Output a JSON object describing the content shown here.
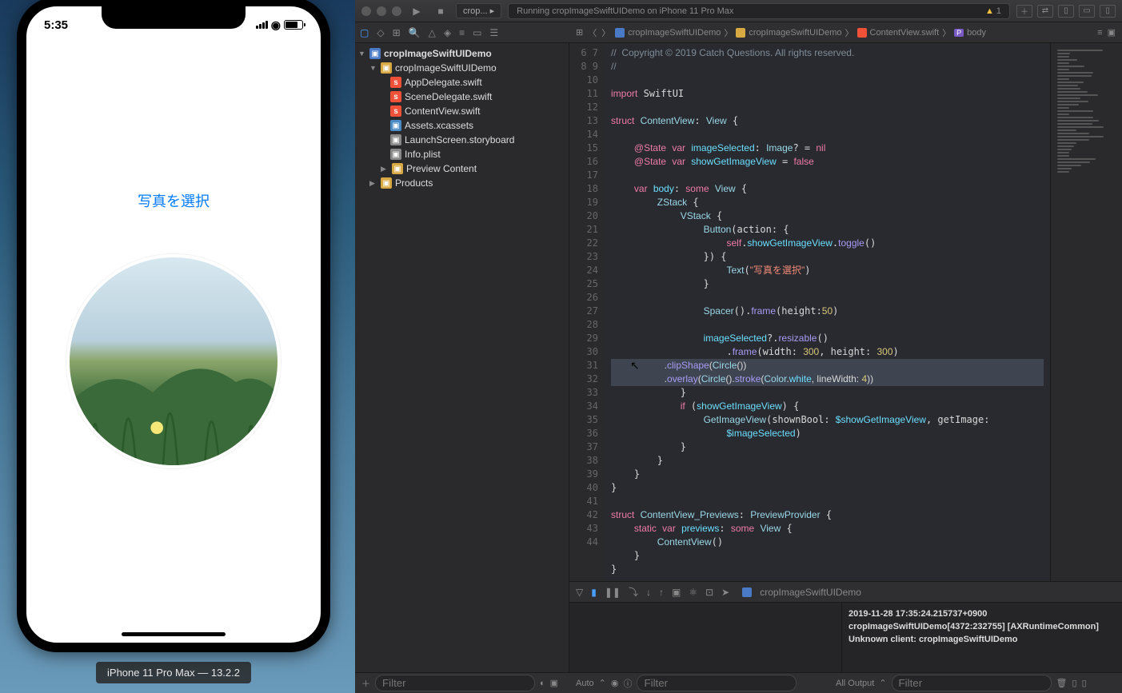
{
  "simulator": {
    "time": "5:35",
    "button_label": "写真を選択",
    "device_label": "iPhone 11 Pro Max — 13.2.2"
  },
  "toolbar": {
    "scheme": "crop...",
    "status_text": "Running cropImageSwiftUIDemo on iPhone 11 Pro Max",
    "warning_count": "1"
  },
  "breadcrumb": {
    "project": "cropImageSwiftUIDemo",
    "folder": "cropImageSwiftUIDemo",
    "file": "ContentView.swift",
    "symbol": "body",
    "symbol_prefix": "P"
  },
  "tree": {
    "root": "cropImageSwiftUIDemo",
    "folder": "cropImageSwiftUIDemo",
    "files": [
      "AppDelegate.swift",
      "SceneDelegate.swift",
      "ContentView.swift",
      "Assets.xcassets",
      "LaunchScreen.storyboard",
      "Info.plist"
    ],
    "preview": "Preview Content",
    "products": "Products"
  },
  "code": {
    "line_start": 6,
    "line_end": 43,
    "lines_html": [
      "<span class='cmt'>//  Copyright © 2019 Catch Questions. All rights reserved.</span>",
      "<span class='cmt'>//</span>",
      "",
      "<span class='kw'>import</span> SwiftUI",
      "",
      "<span class='kw'>struct</span> <span class='type'>ContentView</span>: <span class='type'>View</span> {",
      "",
      "    <span class='kw'>@State</span> <span class='kw'>var</span> <span class='var'>imageSelected</span>: <span class='type'>Image</span>? = <span class='kw'>nil</span>",
      "    <span class='kw'>@State</span> <span class='kw'>var</span> <span class='var'>showGetImageView</span> = <span class='kw'>false</span>",
      "",
      "    <span class='kw'>var</span> <span class='var'>body</span>: <span class='kw'>some</span> <span class='type'>View</span> {",
      "        <span class='type'>ZStack</span> {",
      "            <span class='type'>VStack</span> {",
      "                <span class='type'>Button</span>(action: {",
      "                    <span class='self'>self</span>.<span class='var'>showGetImageView</span>.<span class='fn'>toggle</span>()",
      "                }) {",
      "                    <span class='type'>Text</span>(<span class='str'>\"写真を選択\"</span>)",
      "                }",
      "",
      "                <span class='type'>Spacer</span>().<span class='fn'>frame</span>(height:<span class='num'>50</span>)",
      "",
      "                <span class='var'>imageSelected</span>?.<span class='fn'>resizable</span>()",
      "                    .<span class='fn'>frame</span>(width: <span class='num'>300</span>, height: <span class='num'>300</span>)",
      "                    .<span class='fn'>clipShape</span>(<span class='type'>Circle</span>())",
      "                    .<span class='fn'>overlay</span>(<span class='type'>Circle</span>().<span class='fn'>stroke</span>(<span class='type'>Color</span>.<span class='var'>white</span>, lineWidth: <span class='num'>4</span>))",
      "            }",
      "            <span class='kw'>if</span> (<span class='var'>showGetImageView</span>) {",
      "                <span class='type'>GetImageView</span>(shownBool: <span class='var'>$showGetImageView</span>, getImage:",
      "                    <span class='var'>$imageSelected</span>)",
      "            }",
      "        }",
      "    }",
      "}",
      "",
      "<span class='kw'>struct</span> <span class='type'>ContentView_Previews</span>: <span class='type'>PreviewProvider</span> {",
      "    <span class='kw'>static</span> <span class='kw'>var</span> <span class='var'>previews</span>: <span class='kw'>some</span> <span class='type'>View</span> {",
      "        <span class='type'>ContentView</span>()",
      "    }",
      "}"
    ],
    "highlighted_lines": [
      29,
      30
    ]
  },
  "debug": {
    "target": "cropImageSwiftUIDemo",
    "console_lines": [
      "2019-11-28 17:35:24.215737+0900",
      "cropImageSwiftUIDemo[4372:232755]",
      "[AXRuntimeCommon] Unknown client:",
      "cropImageSwiftUIDemo"
    ]
  },
  "bottom": {
    "filter_placeholder_left": "Filter",
    "auto_label": "Auto",
    "filter_placeholder_mid": "Filter",
    "all_output": "All Output",
    "filter_placeholder_right": "Filter"
  }
}
